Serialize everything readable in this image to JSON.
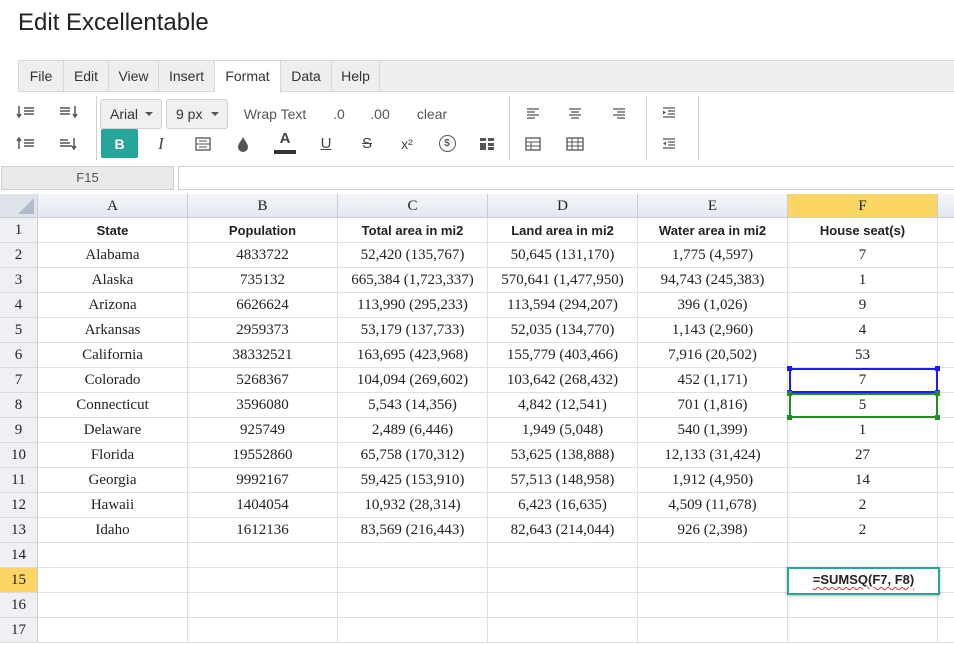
{
  "app": {
    "title": "Edit Excellentable"
  },
  "menu": {
    "items": [
      {
        "label": "File"
      },
      {
        "label": "Edit"
      },
      {
        "label": "View"
      },
      {
        "label": "Insert"
      },
      {
        "label": "Format"
      },
      {
        "label": "Data"
      },
      {
        "label": "Help"
      }
    ],
    "active": "Format"
  },
  "toolbar": {
    "font_family": "Arial",
    "font_size": "9 px",
    "wrap_text": "Wrap Text",
    "decimal_decrease": ".0",
    "decimal_increase": ".00",
    "clear": "clear",
    "bold": "B",
    "italic": "I",
    "text_color": "A",
    "underline": "U",
    "strikethrough": "S",
    "superscript": "x²",
    "currency": "$",
    "accent_color": "#26a69a"
  },
  "formula_bar": {
    "cell_ref": "F15",
    "value": ""
  },
  "sheet": {
    "columns": [
      "A",
      "B",
      "C",
      "D",
      "E",
      "F"
    ],
    "selected_column": "F",
    "rows": [
      "1",
      "2",
      "3",
      "4",
      "5",
      "6",
      "7",
      "8",
      "9",
      "10",
      "11",
      "12",
      "13",
      "14",
      "15",
      "16",
      "17"
    ],
    "selected_row": "15",
    "cells": [
      [
        "State",
        "Population",
        "Total area in mi2",
        "Land area in mi2",
        "Water area in mi2",
        "House seat(s)"
      ],
      [
        "Alabama",
        "4833722",
        "52,420 (135,767)",
        "50,645 (131,170)",
        "1,775 (4,597)",
        "7"
      ],
      [
        "Alaska",
        "735132",
        "665,384 (1,723,337)",
        "570,641 (1,477,950)",
        "94,743 (245,383)",
        "1"
      ],
      [
        "Arizona",
        "6626624",
        "113,990 (295,233)",
        "113,594 (294,207)",
        "396 (1,026)",
        "9"
      ],
      [
        "Arkansas",
        "2959373",
        "53,179 (137,733)",
        "52,035 (134,770)",
        "1,143 (2,960)",
        "4"
      ],
      [
        "California",
        "38332521",
        "163,695 (423,968)",
        "155,779 (403,466)",
        "7,916 (20,502)",
        "53"
      ],
      [
        "Colorado",
        "5268367",
        "104,094 (269,602)",
        "103,642 (268,432)",
        "452 (1,171)",
        "7"
      ],
      [
        "Connecticut",
        "3596080",
        "5,543 (14,356)",
        "4,842 (12,541)",
        "701 (1,816)",
        "5"
      ],
      [
        "Delaware",
        "925749",
        "2,489 (6,446)",
        "1,949 (5,048)",
        "540 (1,399)",
        "1"
      ],
      [
        "Florida",
        "19552860",
        "65,758 (170,312)",
        "53,625 (138,888)",
        "12,133 (31,424)",
        "27"
      ],
      [
        "Georgia",
        "9992167",
        "59,425 (153,910)",
        "57,513 (148,958)",
        "1,912 (4,950)",
        "14"
      ],
      [
        "Hawaii",
        "1404054",
        "10,932 (28,314)",
        "6,423 (16,635)",
        "4,509 (11,678)",
        "2"
      ],
      [
        "Idaho",
        "1612136",
        "83,569 (216,443)",
        "82,643 (214,044)",
        "926 (2,398)",
        "2"
      ]
    ],
    "editing_cell": {
      "ref": "F15",
      "value": "=SUMSQ(F7, F8)"
    },
    "colors": {
      "highlight": "#fcd664",
      "ref1": "#1a1aff",
      "ref2": "#1f8f1f"
    }
  }
}
